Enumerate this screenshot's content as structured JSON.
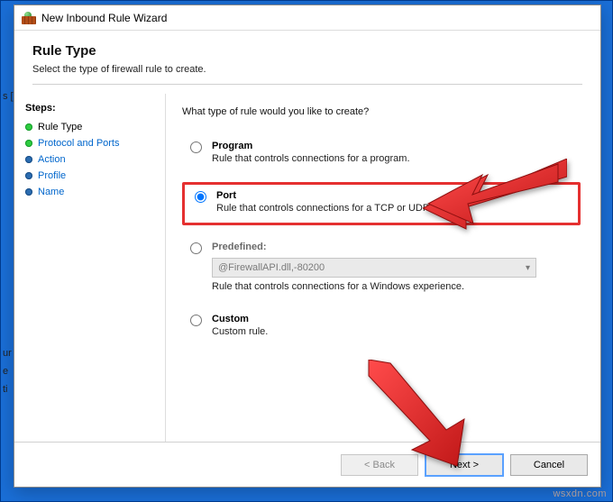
{
  "window": {
    "title": "New Inbound Rule Wizard"
  },
  "header": {
    "heading": "Rule Type",
    "subheading": "Select the type of firewall rule to create."
  },
  "steps": {
    "heading": "Steps:",
    "items": [
      {
        "label": "Rule Type",
        "current": true
      },
      {
        "label": "Protocol and Ports",
        "current": false
      },
      {
        "label": "Action",
        "current": false
      },
      {
        "label": "Profile",
        "current": false
      },
      {
        "label": "Name",
        "current": false
      }
    ]
  },
  "main": {
    "prompt": "What type of rule would you like to create?",
    "options": {
      "program": {
        "label": "Program",
        "description": "Rule that controls connections for a program.",
        "selected": false
      },
      "port": {
        "label": "Port",
        "description": "Rule that controls connections for a TCP or UDP port.",
        "selected": true
      },
      "predefined": {
        "label": "Predefined:",
        "select_text": "@FirewallAPI.dll,-80200",
        "description": "Rule that controls connections for a Windows experience.",
        "selected": false,
        "disabled": true
      },
      "custom": {
        "label": "Custom",
        "description": "Custom rule.",
        "selected": false
      }
    }
  },
  "footer": {
    "back": "< Back",
    "next": "Next >",
    "cancel": "Cancel"
  },
  "partial_text": {
    "a": "s [",
    "b": "ur",
    "c": "e",
    "d": "ti"
  },
  "watermark": "wsxdn.com"
}
